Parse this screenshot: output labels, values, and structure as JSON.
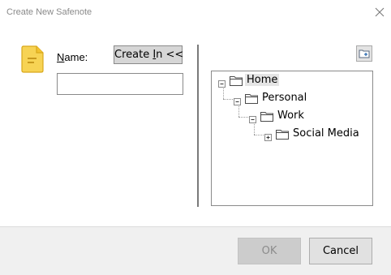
{
  "window": {
    "title": "Create New Safenote"
  },
  "form": {
    "name_label_accel": "N",
    "name_label_rest": "ame:",
    "name_value": "",
    "create_in_prefix": "Create ",
    "create_in_accel": "I",
    "create_in_suffix": "n <<"
  },
  "tree": {
    "items": [
      {
        "label": "Home",
        "level": 0,
        "expanded": true,
        "selected": true
      },
      {
        "label": "Personal",
        "level": 1,
        "expanded": true
      },
      {
        "label": "Work",
        "level": 2,
        "expanded": true
      },
      {
        "label": "Social Media",
        "level": 3,
        "expanded": false
      }
    ]
  },
  "footer": {
    "ok_label": "OK",
    "ok_enabled": false,
    "cancel_label": "Cancel"
  },
  "icons": {
    "note": "note-icon",
    "new_folder": "new-folder-icon",
    "folder": "folder-icon",
    "close": "close-icon",
    "accent": "#f2c230"
  }
}
